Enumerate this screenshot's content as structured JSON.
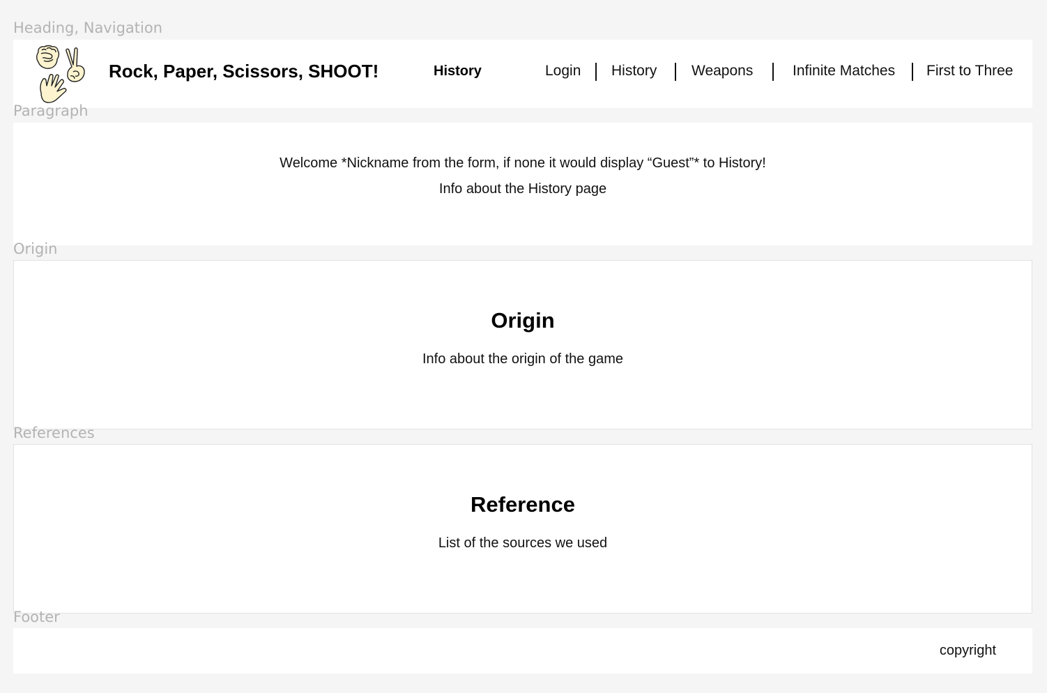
{
  "frame_labels": {
    "heading_nav": "Heading, Navigation",
    "paragraph": "Paragraph",
    "origin": "Origin",
    "references": "References",
    "footer": "Footer"
  },
  "header": {
    "logo_icon": "rock-paper-scissors-hands-icon",
    "site_title": "Rock, Paper, Scissors, SHOOT!",
    "current_page": "History",
    "nav": [
      {
        "label": "Login"
      },
      {
        "label": "History"
      },
      {
        "label": "Weapons"
      },
      {
        "label": "Infinite Matches"
      },
      {
        "label": "First to Three"
      }
    ]
  },
  "paragraph": {
    "welcome": "Welcome *Nickname from the form, if none it would display “Guest”* to History!",
    "info": "Info about the History page"
  },
  "origin": {
    "title": "Origin",
    "text": "Info about the origin of the game"
  },
  "references": {
    "title": "Reference",
    "text": "List of the sources we used"
  },
  "footer": {
    "copyright": "copyright"
  },
  "colors": {
    "background": "#f5f5f5",
    "panel": "#ffffff",
    "label": "#b3b3b3",
    "hand_fill": "#fdf4cf"
  }
}
